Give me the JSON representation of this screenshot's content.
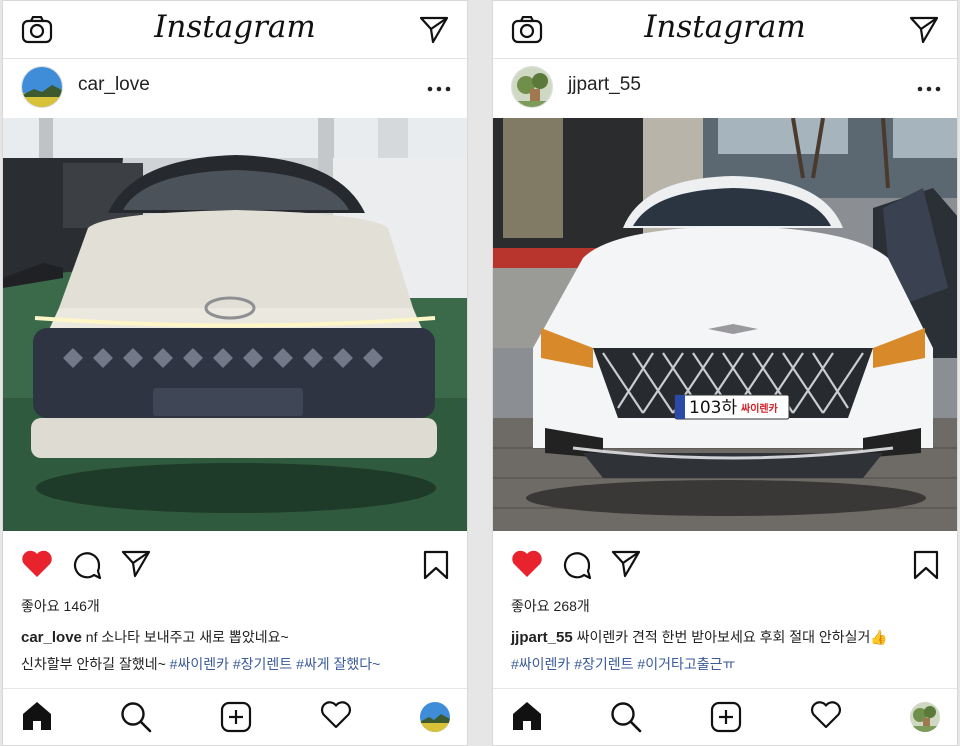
{
  "app_name": "Instagram",
  "posts": [
    {
      "username": "car_love",
      "likes_label": "좋아요 146개",
      "caption_text": "nf 소나타 보내주고 새로 뽑았네요~",
      "caption_line2": "신차할부 안하길 잘했네~",
      "hashtags": [
        "#싸이렌카",
        "#장기렌트",
        "#싸게 잘했다~"
      ],
      "liked": true,
      "accent": "#e8232e"
    },
    {
      "username": "jjpart_55",
      "likes_label": "좋아요 268개",
      "caption_text": "싸이렌카 견적 한번 받아보세요 후회 절대 안하실거👍",
      "hashtags": [
        "#싸이렌카",
        "#장기렌트",
        "#이거타고출근ㅠ"
      ],
      "plate_number": "103하",
      "plate_brand": "싸이렌카",
      "liked": true,
      "accent": "#e8232e"
    }
  ],
  "icons": {
    "top_left": "camera-icon",
    "top_right": "direct-message-icon",
    "post_more": "more-options-icon",
    "actions": [
      "heart-icon",
      "comment-icon",
      "share-icon",
      "bookmark-icon"
    ],
    "bottom_nav": [
      "home-icon",
      "search-icon",
      "add-post-icon",
      "activity-heart-icon",
      "profile-avatar"
    ]
  }
}
